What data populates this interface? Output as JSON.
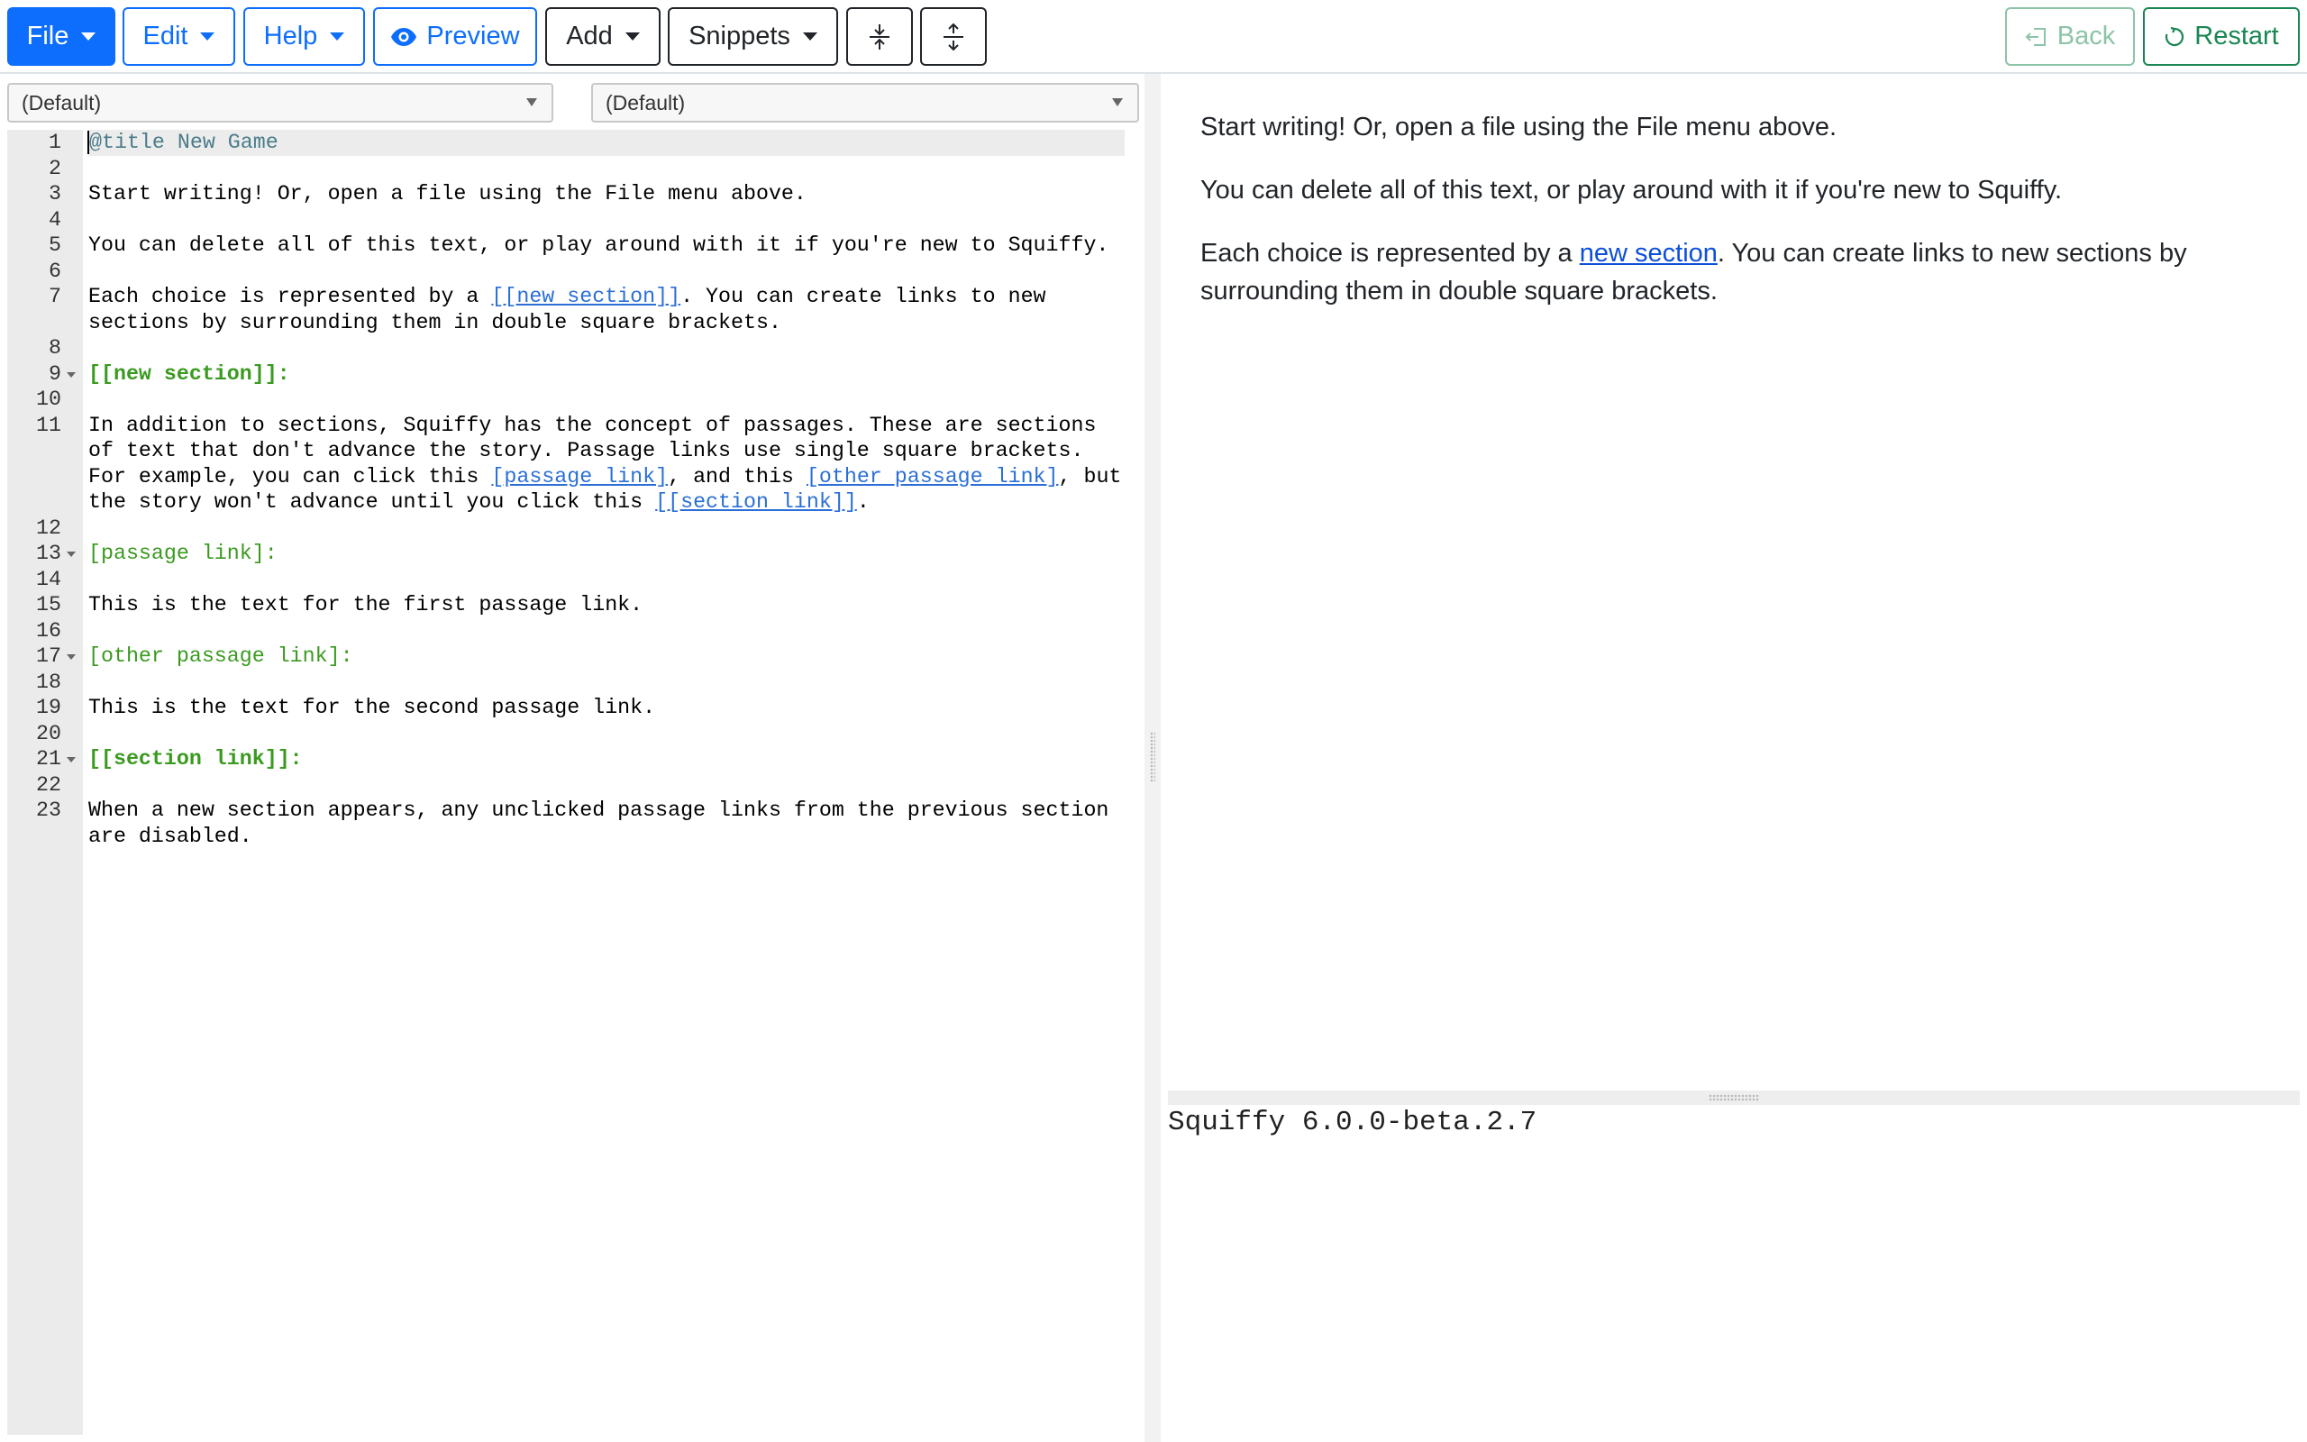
{
  "toolbar": {
    "file_label": "File",
    "edit_label": "Edit",
    "help_label": "Help",
    "preview_label": "Preview",
    "add_label": "Add",
    "snippets_label": "Snippets",
    "back_label": "Back",
    "restart_label": "Restart",
    "colors": {
      "primary": "#0d6efd",
      "dark": "#212529",
      "success": "#198754"
    },
    "icons": [
      "eye-icon",
      "collapse-icon",
      "expand-icon",
      "exit-icon",
      "restart-icon"
    ]
  },
  "selectors": [
    {
      "value": "(Default)"
    },
    {
      "value": "(Default)"
    }
  ],
  "editor": {
    "lines": [
      {
        "n": "1",
        "parts": [
          {
            "t": "@title New Game",
            "c": "meta"
          }
        ]
      },
      {
        "n": "2",
        "parts": []
      },
      {
        "n": "3",
        "parts": [
          {
            "t": "Start writing! Or, open a file using the File menu above."
          }
        ]
      },
      {
        "n": "4",
        "parts": []
      },
      {
        "n": "5",
        "parts": [
          {
            "t": "You can delete all of this text, or play around with it if you're new to Squiffy."
          }
        ]
      },
      {
        "n": "6",
        "parts": []
      },
      {
        "n": "7",
        "parts": [
          {
            "t": "Each choice is represented by a "
          },
          {
            "t": "[[new section]]",
            "c": "link"
          },
          {
            "t": ". You can create links to new sections by surrounding them in double square brackets."
          }
        ]
      },
      {
        "n": "8",
        "parts": []
      },
      {
        "n": "9",
        "fold": true,
        "parts": [
          {
            "t": "[[new section]]:",
            "c": "section"
          }
        ]
      },
      {
        "n": "10",
        "parts": []
      },
      {
        "n": "11",
        "parts": [
          {
            "t": "In addition to sections, Squiffy has the concept of passages. These are sections of text that don't advance the story. Passage links use single square brackets. For example, you can click this "
          },
          {
            "t": "[passage link]",
            "c": "link"
          },
          {
            "t": ", and this "
          },
          {
            "t": "[other passage link]",
            "c": "link"
          },
          {
            "t": ", but the story won't advance until you click this "
          },
          {
            "t": "[[section link]]",
            "c": "link"
          },
          {
            "t": "."
          }
        ]
      },
      {
        "n": "12",
        "parts": []
      },
      {
        "n": "13",
        "fold": true,
        "parts": [
          {
            "t": "[passage link]:",
            "c": "passage"
          }
        ]
      },
      {
        "n": "14",
        "parts": []
      },
      {
        "n": "15",
        "parts": [
          {
            "t": "This is the text for the first passage link."
          }
        ]
      },
      {
        "n": "16",
        "parts": []
      },
      {
        "n": "17",
        "fold": true,
        "parts": [
          {
            "t": "[other passage link]:",
            "c": "passage"
          }
        ]
      },
      {
        "n": "18",
        "parts": []
      },
      {
        "n": "19",
        "parts": [
          {
            "t": "This is the text for the second passage link."
          }
        ]
      },
      {
        "n": "20",
        "parts": []
      },
      {
        "n": "21",
        "fold": true,
        "parts": [
          {
            "t": "[[section link]]:",
            "c": "section"
          }
        ]
      },
      {
        "n": "22",
        "parts": []
      },
      {
        "n": "23",
        "parts": [
          {
            "t": "When a new section appears, any unclicked passage links from the previous section are disabled."
          }
        ]
      }
    ]
  },
  "preview": {
    "p1": "Start writing! Or, open a file using the File menu above.",
    "p2": "You can delete all of this text, or play around with it if you're new to Squiffy.",
    "p3_before": "Each choice is represented by a ",
    "p3_link": "new section",
    "p3_after": ". You can create links to new sections by surrounding them in double square brackets."
  },
  "footer": {
    "version": "Squiffy 6.0.0-beta.2.7"
  }
}
